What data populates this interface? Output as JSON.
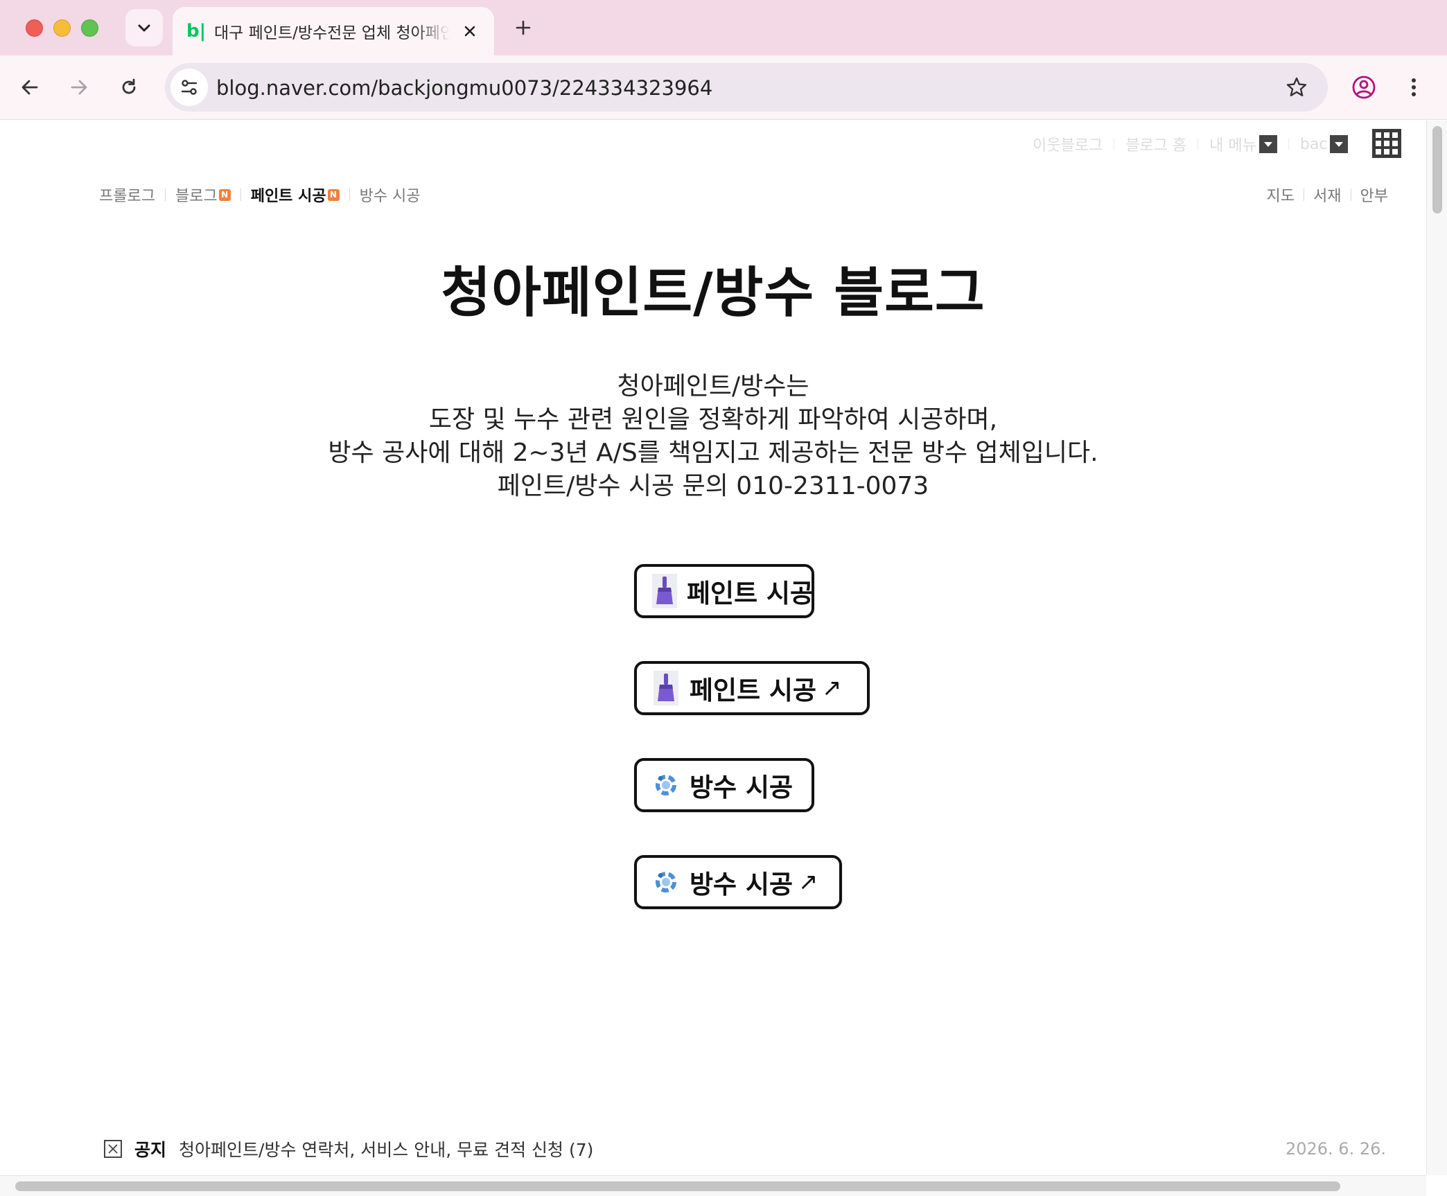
{
  "browser": {
    "tab_favicon": "b|",
    "tab_title": "대구 페인트/방수전문 업체 청아페인트",
    "url": "blog.naver.com/backjongmu0073/224334323964"
  },
  "gnb": {
    "neighbor_blog": "이웃블로그",
    "blog_home": "블로그 홈",
    "my_menu": "내 메뉴",
    "user": "bac"
  },
  "menu": {
    "prologue": "프롤로그",
    "blog": "블로그",
    "paint": "페인트 시공",
    "waterproof": "방수 시공",
    "new_badge": "N",
    "map": "지도",
    "bookshelf": "서재",
    "greeting": "안부"
  },
  "main": {
    "title": "청아페인트/방수 블로그",
    "intro": [
      "청아페인트/방수는",
      "도장 및 누수 관련 원인을 정확하게 파악하여 시공하며,",
      "방수 공사에 대해 2~3년 A/S를 책임지고 제공하는 전문 방수 업체입니다.",
      "페인트/방수 시공 문의 010-2311-0073"
    ],
    "buttons": [
      {
        "label": "페인트 시공",
        "arrow": "",
        "icon": "paint-brush-icon"
      },
      {
        "label": "페인트 시공",
        "arrow": "↗",
        "icon": "paint-brush-icon"
      },
      {
        "label": "방수 시공",
        "arrow": "",
        "icon": "water-drop-icon"
      },
      {
        "label": "방수 시공",
        "arrow": "↗",
        "icon": "water-drop-icon"
      }
    ]
  },
  "notice": {
    "label": "공지",
    "text": "청아페인트/방수 연락처, 서비스 안내, 무료 견적 신청 (7)",
    "date": "2026. 6. 26."
  },
  "colors": {
    "tabbar": "#f3d8e6",
    "toolbar": "#fdf4f8",
    "naver_green": "#03c75a",
    "new_badge": "#f0813c"
  }
}
